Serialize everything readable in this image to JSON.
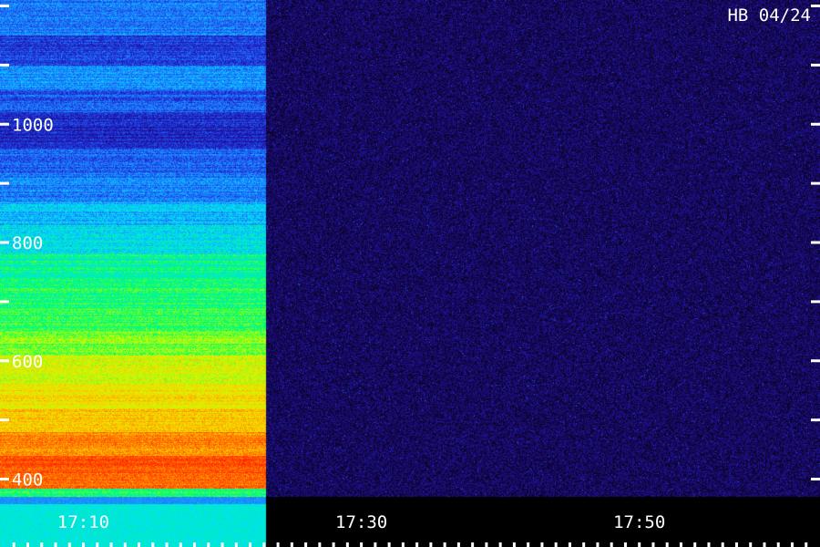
{
  "station_label": "HB 04/24",
  "chart_data": {
    "type": "heatmap",
    "title": "",
    "xlabel": "",
    "ylabel": "",
    "x_ticks": [
      "17:10",
      "17:30",
      "17:50"
    ],
    "x_tick_values_min": [
      10,
      30,
      50
    ],
    "x_minor_tick_interval_min": 5,
    "x_range_min": [
      4,
      63
    ],
    "y_ticks": [
      1000,
      800,
      600,
      400
    ],
    "y_minor_tick_interval": 100,
    "y_range": [
      370,
      1210
    ],
    "signal_end_min": 23.15,
    "colormap": [
      "#000000",
      "#1a0866",
      "#2020c8",
      "#1e78ff",
      "#00e0ff",
      "#00ff60",
      "#c8ff00",
      "#ffd000",
      "#ff6a00",
      "#ff1a00"
    ],
    "band_levels": [
      {
        "y_from": 1210,
        "y_to": 1150,
        "level": 0.33
      },
      {
        "y_from": 1150,
        "y_to": 1100,
        "level": 0.26
      },
      {
        "y_from": 1100,
        "y_to": 1060,
        "level": 0.36
      },
      {
        "y_from": 1060,
        "y_to": 1020,
        "level": 0.29
      },
      {
        "y_from": 1020,
        "y_to": 960,
        "level": 0.22
      },
      {
        "y_from": 960,
        "y_to": 920,
        "level": 0.3
      },
      {
        "y_from": 920,
        "y_to": 870,
        "level": 0.34
      },
      {
        "y_from": 870,
        "y_to": 830,
        "level": 0.4
      },
      {
        "y_from": 830,
        "y_to": 780,
        "level": 0.45
      },
      {
        "y_from": 780,
        "y_to": 740,
        "level": 0.52
      },
      {
        "y_from": 740,
        "y_to": 690,
        "level": 0.55
      },
      {
        "y_from": 690,
        "y_to": 650,
        "level": 0.57
      },
      {
        "y_from": 650,
        "y_to": 610,
        "level": 0.62
      },
      {
        "y_from": 610,
        "y_to": 560,
        "level": 0.7
      },
      {
        "y_from": 560,
        "y_to": 520,
        "level": 0.74
      },
      {
        "y_from": 520,
        "y_to": 480,
        "level": 0.78
      },
      {
        "y_from": 480,
        "y_to": 440,
        "level": 0.86
      },
      {
        "y_from": 440,
        "y_to": 410,
        "level": 0.92
      },
      {
        "y_from": 410,
        "y_to": 385,
        "level": 0.9
      },
      {
        "y_from": 385,
        "y_to": 370,
        "level": 0.55
      }
    ],
    "background_level": 0.1
  }
}
